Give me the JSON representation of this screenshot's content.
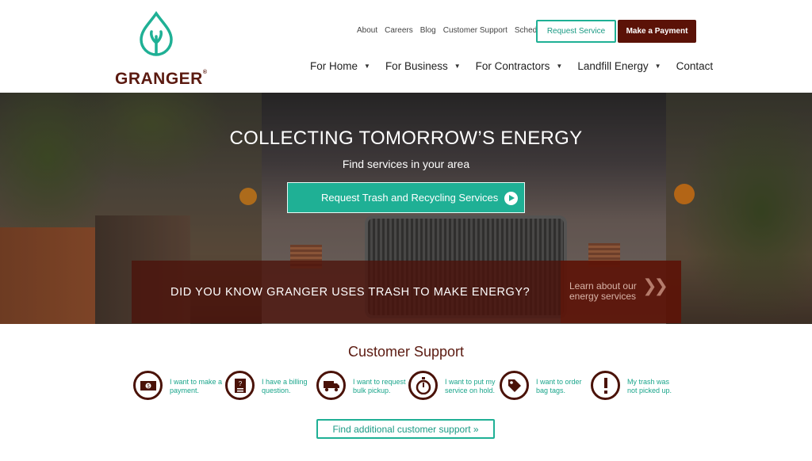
{
  "brand": {
    "name": "GRANGER",
    "trademark": "®",
    "logo_color": "#1fb095",
    "text_color": "#5b1a10"
  },
  "utility_nav": [
    "About",
    "Careers",
    "Blog",
    "Customer Support",
    "Schedule"
  ],
  "header_buttons": {
    "request": "Request Service",
    "payment": "Make a Payment"
  },
  "main_nav": [
    {
      "label": "For Home",
      "has_dropdown": true
    },
    {
      "label": "For Business",
      "has_dropdown": true
    },
    {
      "label": "For Contractors",
      "has_dropdown": true
    },
    {
      "label": "Landfill Energy",
      "has_dropdown": true
    },
    {
      "label": "Contact",
      "has_dropdown": false
    }
  ],
  "hero": {
    "title": "COLLECTING TOMORROW’S ENERGY",
    "subtitle": "Find services in your area",
    "cta": "Request Trash and Recycling Services",
    "banner": "DID YOU KNOW GRANGER USES TRASH TO MAKE ENERGY?",
    "learn_more_line1": "Learn about our",
    "learn_more_line2": "energy services",
    "learn_more_icon": "double-chevron-right-icon"
  },
  "support": {
    "title": "Customer Support",
    "items": [
      {
        "icon": "money-icon",
        "label": "I want to make a payment."
      },
      {
        "icon": "bill-document-icon",
        "label": "I have a billing question."
      },
      {
        "icon": "truck-icon",
        "label": "I want to request bulk pickup."
      },
      {
        "icon": "stopwatch-icon",
        "label": "I want to put my service on hold."
      },
      {
        "icon": "tag-icon",
        "label": "I want to order bag tags."
      },
      {
        "icon": "exclamation-icon",
        "label": "My trash was not picked up."
      }
    ],
    "more_link": "Find additional customer support »"
  },
  "colors": {
    "teal": "#1fb095",
    "maroon": "#5b1207"
  }
}
